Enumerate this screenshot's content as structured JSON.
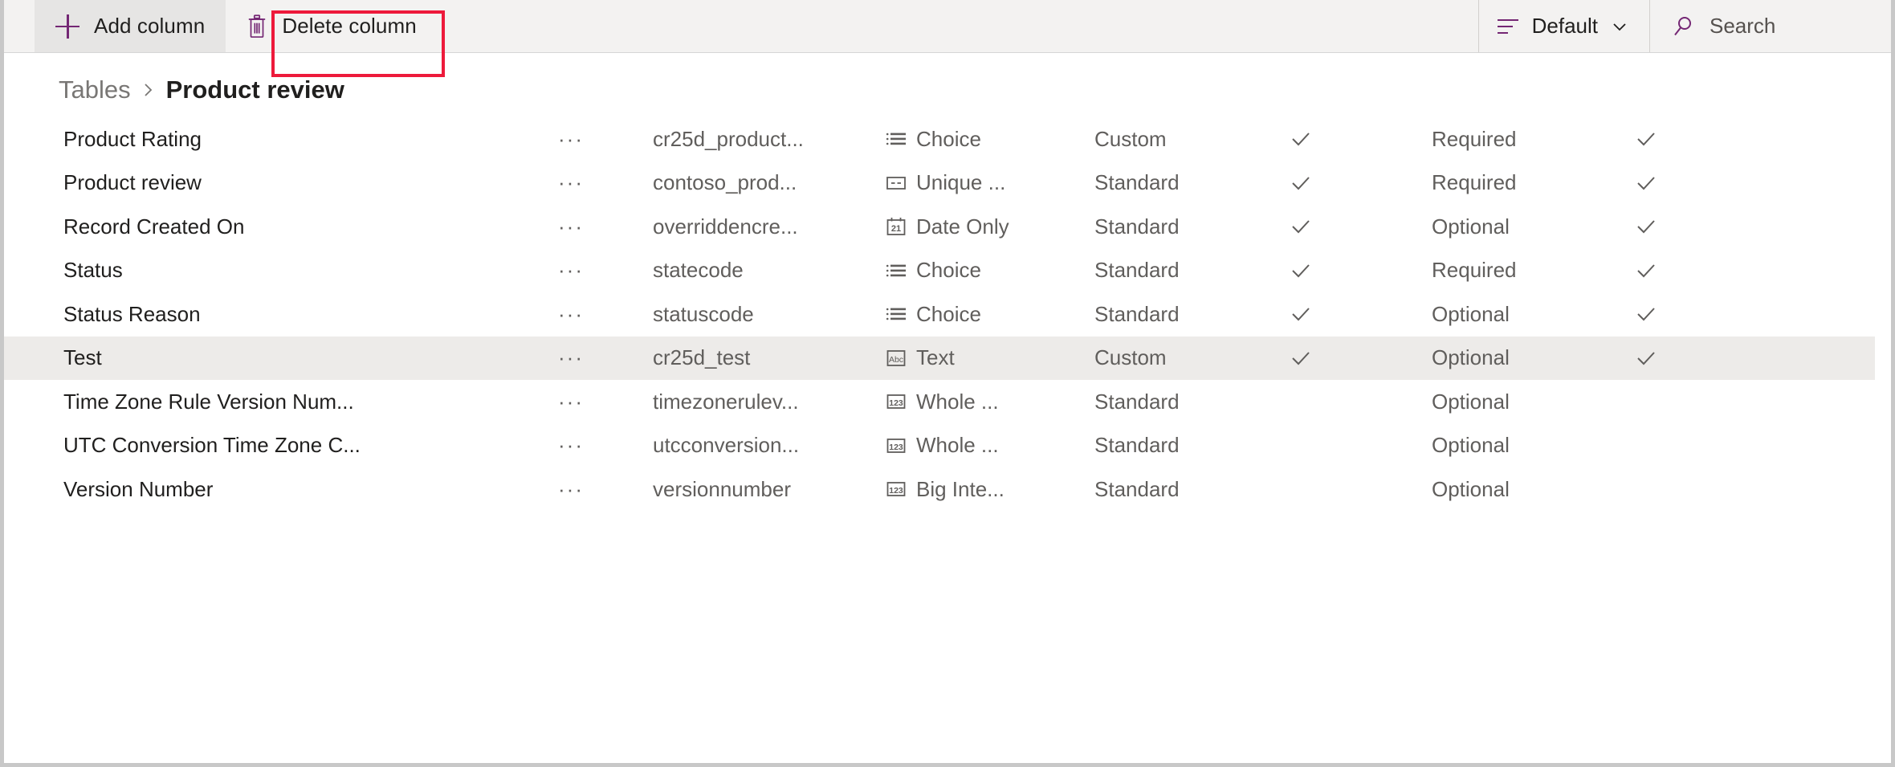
{
  "toolbar": {
    "add_column_label": "Add column",
    "delete_column_label": "Delete column",
    "view_label": "Default",
    "search_placeholder": "Search",
    "highlight_color": "#ed1a3b",
    "accent_color": "#742774"
  },
  "breadcrumb": {
    "parent": "Tables",
    "separator": ">",
    "current": "Product review"
  },
  "grid": {
    "rows": [
      {
        "display_name": "Product Rating",
        "more": "···",
        "logical_name": "cr25d_product...",
        "data_type": "Choice",
        "type_icon": "choice-icon",
        "custom_type": "Custom",
        "check1": "✓",
        "requirement": "Required",
        "check2": "✓",
        "selected": false
      },
      {
        "display_name": "Product review",
        "more": "···",
        "logical_name": "contoso_prod...",
        "data_type": "Unique ...",
        "type_icon": "unique-identifier-icon",
        "custom_type": "Standard",
        "check1": "✓",
        "requirement": "Required",
        "check2": "✓",
        "selected": false
      },
      {
        "display_name": "Record Created On",
        "more": "···",
        "logical_name": "overriddencre...",
        "data_type": "Date Only",
        "type_icon": "calendar-icon",
        "custom_type": "Standard",
        "check1": "✓",
        "requirement": "Optional",
        "check2": "✓",
        "selected": false
      },
      {
        "display_name": "Status",
        "more": "···",
        "logical_name": "statecode",
        "data_type": "Choice",
        "type_icon": "choice-icon",
        "custom_type": "Standard",
        "check1": "✓",
        "requirement": "Required",
        "check2": "✓",
        "selected": false
      },
      {
        "display_name": "Status Reason",
        "more": "···",
        "logical_name": "statuscode",
        "data_type": "Choice",
        "type_icon": "choice-icon",
        "custom_type": "Standard",
        "check1": "✓",
        "requirement": "Optional",
        "check2": "✓",
        "selected": false
      },
      {
        "display_name": "Test",
        "more": "···",
        "logical_name": "cr25d_test",
        "data_type": "Text",
        "type_icon": "text-abc-icon",
        "custom_type": "Custom",
        "check1": "✓",
        "requirement": "Optional",
        "check2": "✓",
        "selected": true
      },
      {
        "display_name": "Time Zone Rule Version Num...",
        "more": "···",
        "logical_name": "timezonerulev...",
        "data_type": "Whole ...",
        "type_icon": "number-123-icon",
        "custom_type": "Standard",
        "check1": "",
        "requirement": "Optional",
        "check2": "",
        "selected": false
      },
      {
        "display_name": "UTC Conversion Time Zone C...",
        "more": "···",
        "logical_name": "utcconversion...",
        "data_type": "Whole ...",
        "type_icon": "number-123-icon",
        "custom_type": "Standard",
        "check1": "",
        "requirement": "Optional",
        "check2": "",
        "selected": false
      },
      {
        "display_name": "Version Number",
        "more": "···",
        "logical_name": "versionnumber",
        "data_type": "Big Inte...",
        "type_icon": "number-123-icon",
        "custom_type": "Standard",
        "check1": "",
        "requirement": "Optional",
        "check2": "",
        "selected": false
      }
    ]
  }
}
